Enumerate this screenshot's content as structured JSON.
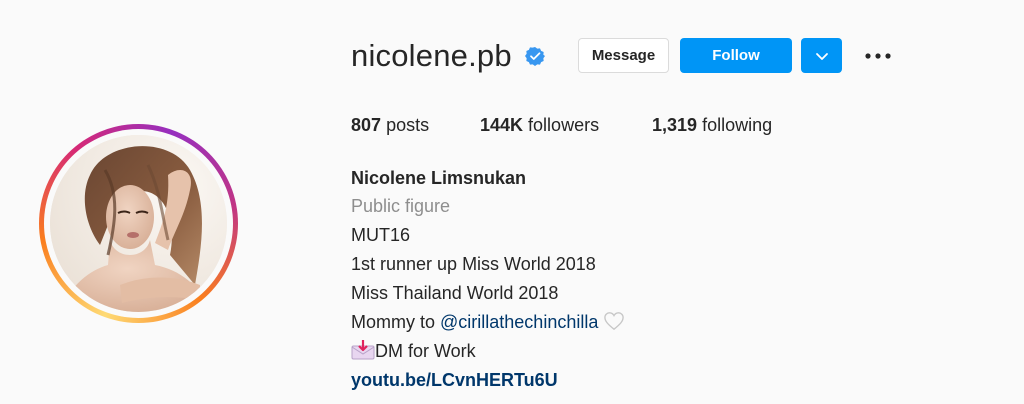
{
  "profile": {
    "username": "nicolene.pb",
    "verified_icon": "verified-badge-icon",
    "avatar_description_icon": "profile-photo"
  },
  "actions": {
    "message_label": "Message",
    "follow_label": "Follow",
    "dropdown_icon": "chevron-down-icon",
    "more_icon": "more-options-icon"
  },
  "stats": {
    "posts_count": "807",
    "posts_label": "posts",
    "followers_count": "144K",
    "followers_label": "followers",
    "following_count": "1,319",
    "following_label": "following"
  },
  "bio": {
    "full_name": "Nicolene Limsnukan",
    "category": "Public figure",
    "line1": "MUT16",
    "line2": "1st runner up Miss World 2018",
    "line3": "Miss Thailand World 2018",
    "line4_prefix": "Mommy to ",
    "line4_mention": "@cirillathechinchilla",
    "line4_icon": "heart-outline-icon",
    "line5_icon": "envelope-download-icon",
    "line5_text": "DM for Work",
    "link": "youtu.be/LCvnHERTu6U"
  },
  "colors": {
    "accent_blue": "#0095f6",
    "link_blue": "#00376b",
    "muted_gray": "#8e8e8e",
    "text_dark": "#262626",
    "background": "#fafafa"
  }
}
